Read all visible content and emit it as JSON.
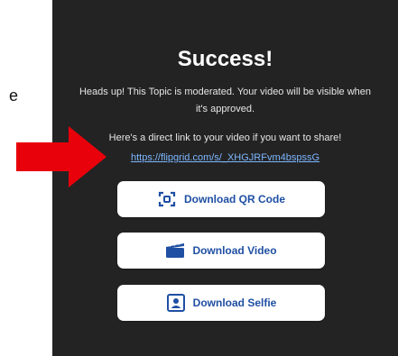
{
  "stray_text": "e",
  "dialog": {
    "title": "Success!",
    "moderation_message": "Heads up! This Topic is moderated. Your video will be visible when it's approved.",
    "share_prompt": "Here's a direct link to your video if you want to share!",
    "share_link": "https://flipgrid.com/s/_XHGJRFvm4bspssG",
    "buttons": [
      {
        "label": "Download QR Code",
        "icon": "qr-code-icon"
      },
      {
        "label": "Download Video",
        "icon": "clapperboard-icon"
      },
      {
        "label": "Download Selfie",
        "icon": "portrait-icon"
      }
    ]
  },
  "annotation": {
    "icon": "red-arrow-icon",
    "color": "#e8000b"
  },
  "colors": {
    "panel": "#232323",
    "link": "#7db7ff",
    "button_text": "#1f4fa3"
  }
}
